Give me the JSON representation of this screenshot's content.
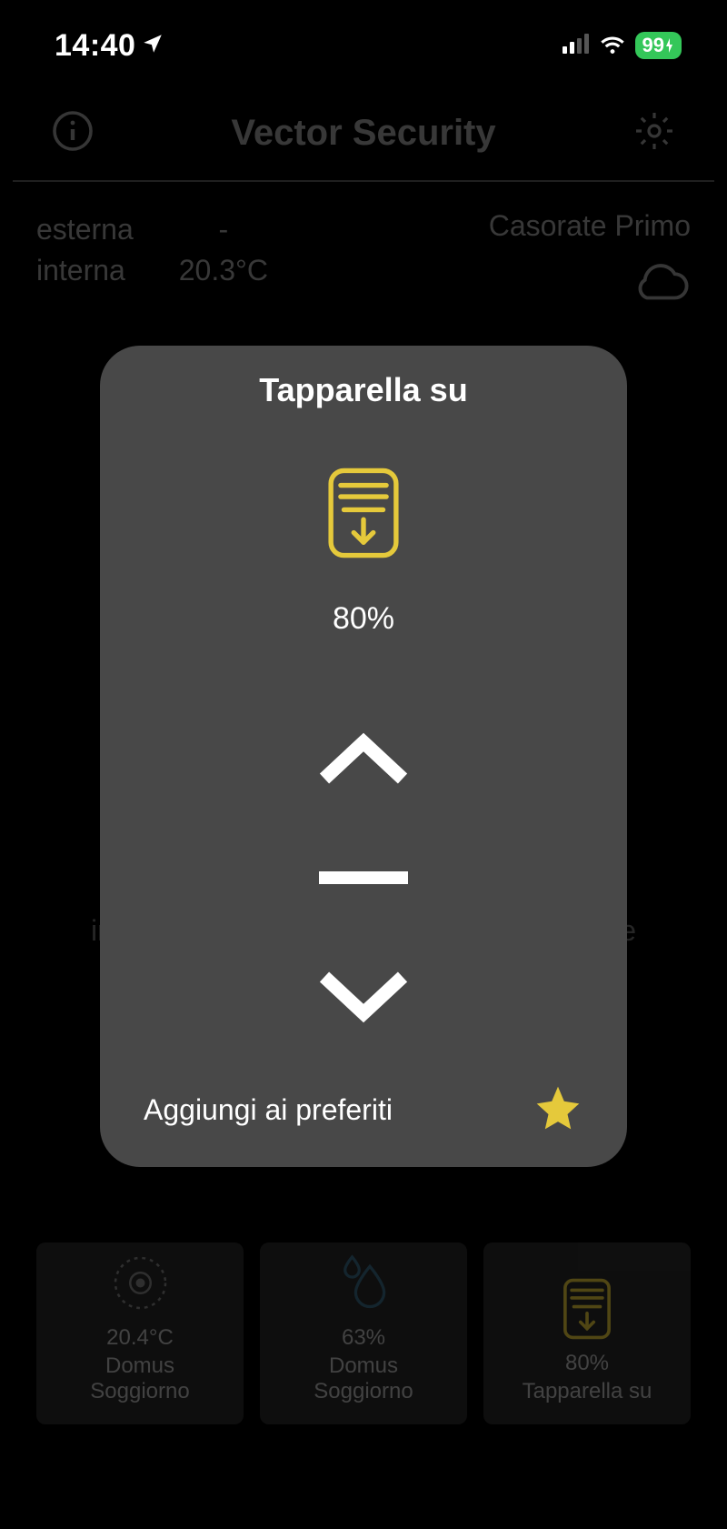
{
  "status": {
    "time": "14:40",
    "battery": "99"
  },
  "header": {
    "title": "Vector Security"
  },
  "weather": {
    "label_outside": "esterna",
    "label_inside": "interna",
    "value_outside": "-",
    "value_inside": "20.3°C",
    "city": "Casorate Primo"
  },
  "modal": {
    "title": "Tapparella su",
    "percent": "80%",
    "favorite_label": "Aggiungi ai preferiti"
  },
  "tiles": [
    {
      "value": "20.4°C",
      "line1": "Domus",
      "line2": "Soggiorno"
    },
    {
      "value": "63%",
      "line1": "Domus",
      "line2": "Soggiorno"
    },
    {
      "value": "80%",
      "line1": "Tapparella su",
      "line2": ""
    }
  ],
  "bg_hint": {
    "left": "ir",
    "right": "e"
  }
}
